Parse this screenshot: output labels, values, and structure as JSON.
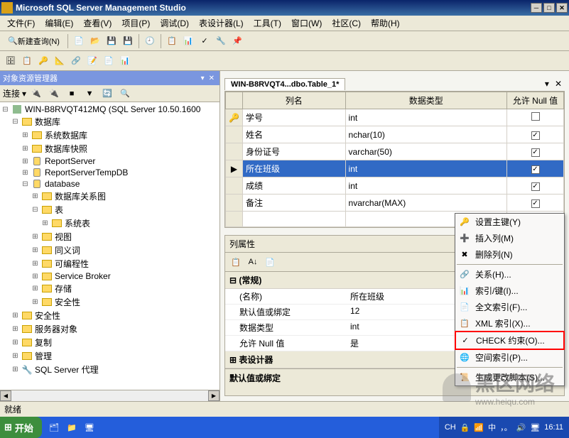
{
  "app": {
    "title": "Microsoft SQL Server Management Studio"
  },
  "menu": {
    "file": "文件(F)",
    "edit": "编辑(E)",
    "view": "查看(V)",
    "project": "项目(P)",
    "debug": "调试(D)",
    "designer": "表设计器(L)",
    "tools": "工具(T)",
    "window": "窗口(W)",
    "community": "社区(C)",
    "help": "帮助(H)"
  },
  "toolbar": {
    "new_query": "新建查询(N)"
  },
  "explorer": {
    "title": "对象资源管理器",
    "connect": "连接",
    "server": "WIN-B8RVQT412MQ (SQL Server 10.50.1600",
    "databases": "数据库",
    "sysdb": "系统数据库",
    "snapshots": "数据库快照",
    "reportserver": "ReportServer",
    "reportservertemp": "ReportServerTempDB",
    "database": "database",
    "diagrams": "数据库关系图",
    "tables": "表",
    "systables": "系统表",
    "views": "视图",
    "synonyms": "同义词",
    "programmability": "可编程性",
    "servicebroker": "Service Broker",
    "storage": "存储",
    "security_node": "安全性",
    "security": "安全性",
    "serverobjects": "服务器对象",
    "replication": "复制",
    "management": "管理",
    "agent": "SQL Server 代理"
  },
  "designer_tab": {
    "title": "WIN-B8RVQT4...dbo.Table_1*"
  },
  "columns": {
    "header_name": "列名",
    "header_type": "数据类型",
    "header_null": "允许 Null 值",
    "rows": [
      {
        "name": "学号",
        "type": "int",
        "null": false,
        "pk": true
      },
      {
        "name": "姓名",
        "type": "nchar(10)",
        "null": true,
        "pk": false
      },
      {
        "name": "身份证号",
        "type": "varchar(50)",
        "null": true,
        "pk": false
      },
      {
        "name": "所在班级",
        "type": "int",
        "null": true,
        "pk": false,
        "selected": true
      },
      {
        "name": "成绩",
        "type": "int",
        "null": true,
        "pk": false
      },
      {
        "name": "备注",
        "type": "nvarchar(MAX)",
        "null": true,
        "pk": false
      }
    ]
  },
  "props": {
    "title": "列属性",
    "cat_general": "(常规)",
    "name_label": "(名称)",
    "name_value": "所在班级",
    "default_label": "默认值或绑定",
    "default_value": "12",
    "type_label": "数据类型",
    "type_value": "int",
    "null_label": "允许 Null 值",
    "null_value": "是",
    "cat_designer": "表设计器",
    "desc": "默认值或绑定"
  },
  "context_menu": {
    "set_pk": "设置主键(Y)",
    "insert_col": "插入列(M)",
    "delete_col": "删除列(N)",
    "relationships": "关系(H)...",
    "indexes": "索引/键(I)...",
    "fulltext": "全文索引(F)...",
    "xml_index": "XML 索引(X)...",
    "check": "CHECK 约束(O)...",
    "spatial": "空间索引(P)...",
    "script": "生成更改脚本(S)..."
  },
  "status": {
    "ready": "就绪"
  },
  "taskbar": {
    "start": "开始",
    "lang": "CH",
    "ime": "中",
    "time": "16:11"
  },
  "watermark": {
    "text": "黑区网络",
    "url": "www.heiqu.com"
  }
}
